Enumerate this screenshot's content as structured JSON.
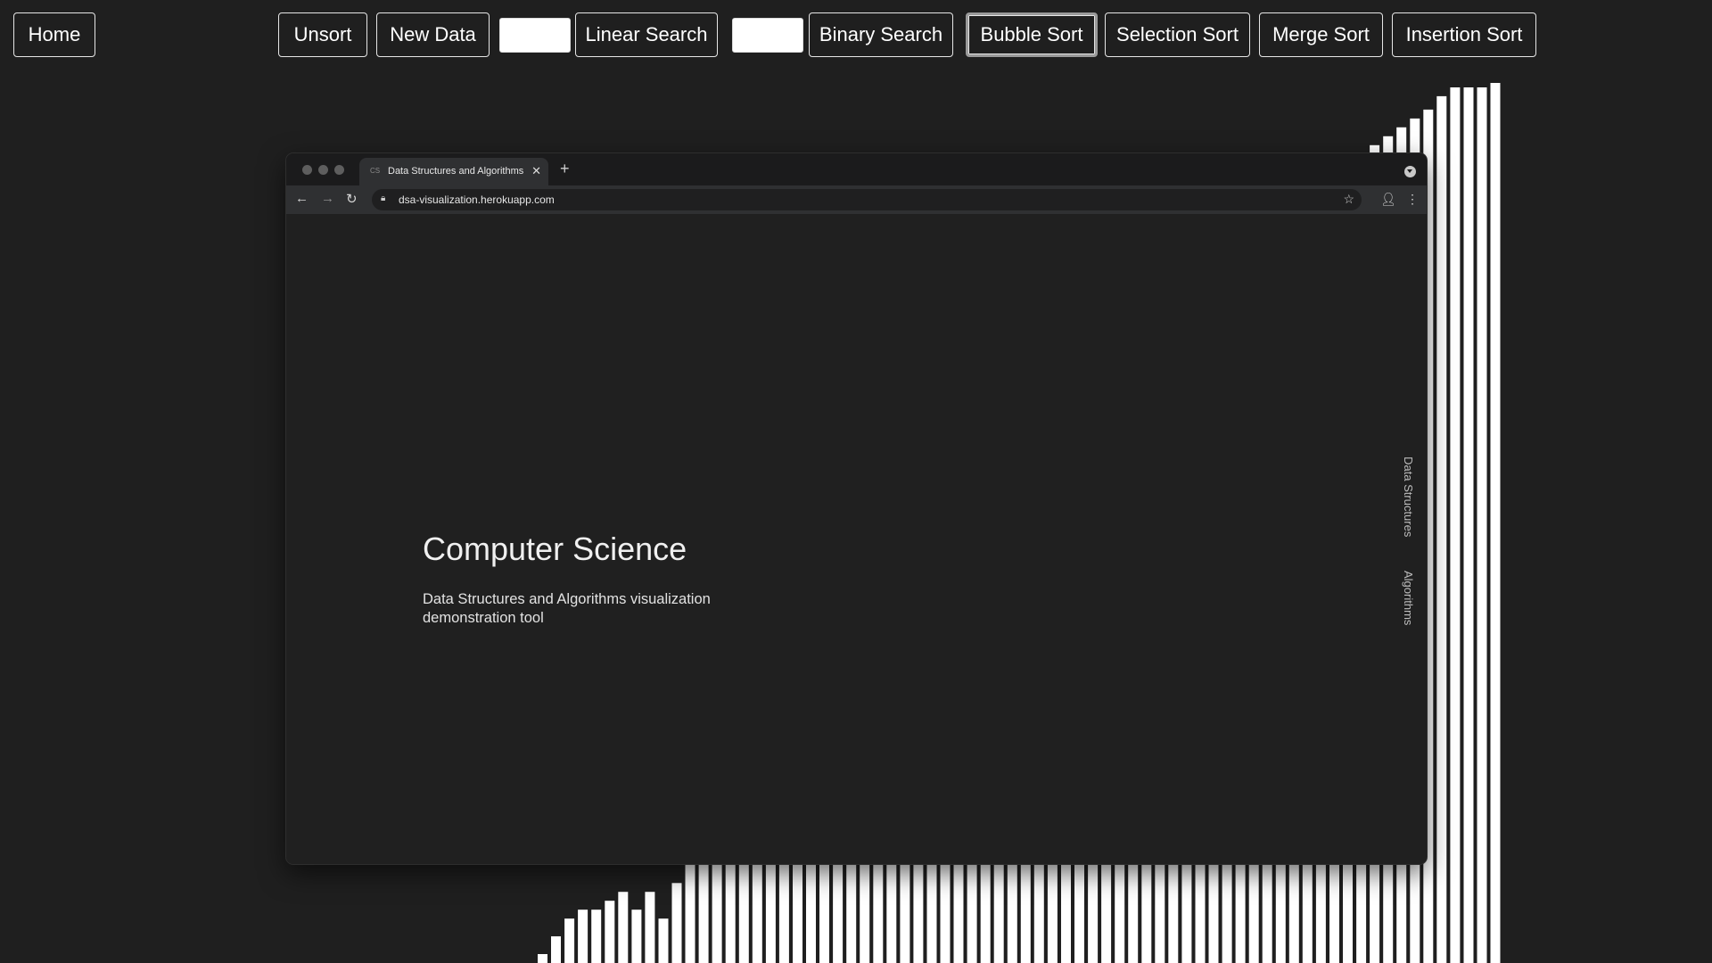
{
  "toolbar": {
    "home_label": "Home",
    "unsort_label": "Unsort",
    "new_data_label": "New Data",
    "linear_search_input_value": "",
    "linear_search_label": "Linear Search",
    "binary_search_input_value": "",
    "binary_search_label": "Binary Search",
    "bubble_sort_label": "Bubble Sort",
    "selection_sort_label": "Selection Sort",
    "merge_sort_label": "Merge Sort",
    "insertion_sort_label": "Insertion Sort",
    "active_algorithm": "Bubble Sort"
  },
  "colors": {
    "background": "#1f1f1f",
    "bar": "#ffffff",
    "button_border": "#e6e6e6"
  },
  "bars": {
    "count": 72,
    "relative_heights": [
      0.01,
      0.03,
      0.05,
      0.06,
      0.06,
      0.07,
      0.08,
      0.06,
      0.08,
      0.05,
      0.09,
      0.14,
      0.16,
      0.2,
      0.22,
      0.26,
      0.3,
      0.33,
      0.36,
      0.39,
      0.41,
      0.43,
      0.45,
      0.47,
      0.49,
      0.51,
      0.53,
      0.55,
      0.57,
      0.58,
      0.59,
      0.6,
      0.61,
      0.62,
      0.63,
      0.64,
      0.65,
      0.66,
      0.67,
      0.68,
      0.69,
      0.7,
      0.71,
      0.72,
      0.73,
      0.74,
      0.75,
      0.76,
      0.77,
      0.78,
      0.79,
      0.8,
      0.81,
      0.82,
      0.83,
      0.84,
      0.85,
      0.86,
      0.87,
      0.88,
      0.9,
      0.91,
      0.92,
      0.93,
      0.94,
      0.95,
      0.96,
      0.975,
      0.985,
      0.985,
      0.985,
      0.99
    ]
  },
  "browser": {
    "tab_favicon": "CS",
    "tab_title": "Data Structures and Algorithms",
    "tab_close_icon": "close-icon",
    "new_tab_icon": "plus-icon",
    "url": "dsa-visualization.herokuapp.com",
    "hero_title": "Computer Science",
    "hero_subtitle": "Data Structures and Algorithms visualization demonstration tool",
    "side_link_1": "Data Structures",
    "side_link_2": "Algorithms"
  }
}
